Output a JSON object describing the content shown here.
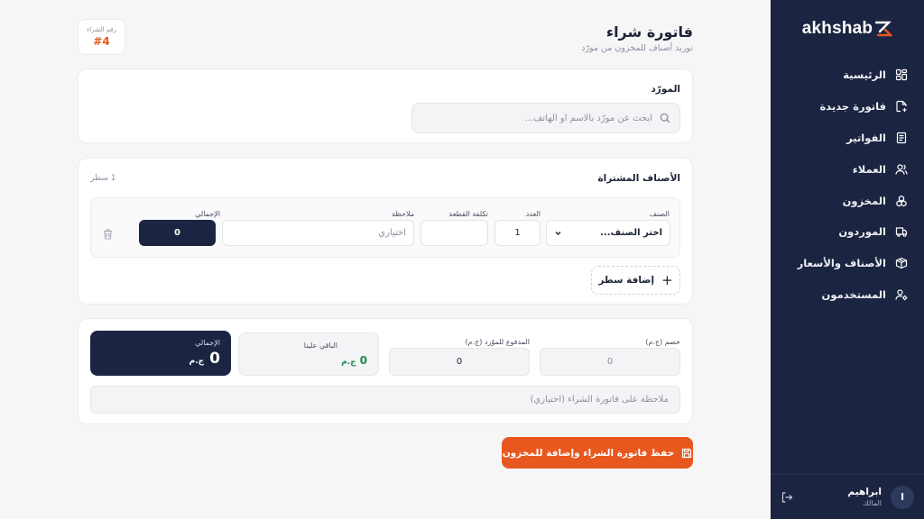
{
  "brand": {
    "name": "akhshab"
  },
  "sidebar": {
    "items": [
      {
        "label": "الرئيسية",
        "icon": "dashboard-icon"
      },
      {
        "label": "فاتورة جديدة",
        "icon": "new-invoice-icon"
      },
      {
        "label": "الفواتير",
        "icon": "invoices-icon"
      },
      {
        "label": "العملاء",
        "icon": "customers-icon"
      },
      {
        "label": "المخزون",
        "icon": "inventory-icon"
      },
      {
        "label": "الموردون",
        "icon": "truck-icon"
      },
      {
        "label": "الأصناف والأسعار",
        "icon": "box-icon"
      },
      {
        "label": "المستخدمون",
        "icon": "users-settings-icon"
      }
    ],
    "user": {
      "initial": "I",
      "name": "ابراهيم",
      "role": "المالك"
    }
  },
  "header": {
    "title": "فاتورة شراء",
    "subtitle": "توريد أصناف للمخزون من مورّد",
    "purchase_number_label": "رقم الشراء",
    "purchase_number": "#4"
  },
  "supplier": {
    "title": "المورّد",
    "search_placeholder": "ابحث عن مورّد بالاسم أو الهاتف..."
  },
  "items": {
    "title": "الأصناف المشتراة",
    "row_count": "1 سطر",
    "labels": {
      "item": "الصنف",
      "qty": "العدد",
      "unit_cost": "تكلفة القطعة",
      "note": "ملاحظة",
      "total": "الإجمالي"
    },
    "row": {
      "item_select": "اختر الصنف...",
      "qty": "1",
      "unit_cost": "",
      "note_placeholder": "اختياري",
      "total": "0"
    },
    "add_line": "إضافة سطر"
  },
  "summary": {
    "discount_label": "خصم (ج.م)",
    "discount_value": "0",
    "paid_label": "المدفوع للموّرد (ج.م)",
    "paid_value": "0",
    "remaining_label": "الباقي علينا",
    "remaining_value": "0",
    "remaining_currency": "ج.م",
    "total_label": "الإجمالي",
    "total_value": "0",
    "total_currency": "ج.م",
    "note_placeholder": "ملاحظة على فاتورة الشراء (اختياري)"
  },
  "save_button": "حفظ فاتورة الشراء وإضافة للمخزون",
  "colors": {
    "sidebar_bg": "#1b2440",
    "accent": "#e8571e",
    "remaining_green": "#1f8a4c",
    "page_bg": "#f6f6f7"
  }
}
